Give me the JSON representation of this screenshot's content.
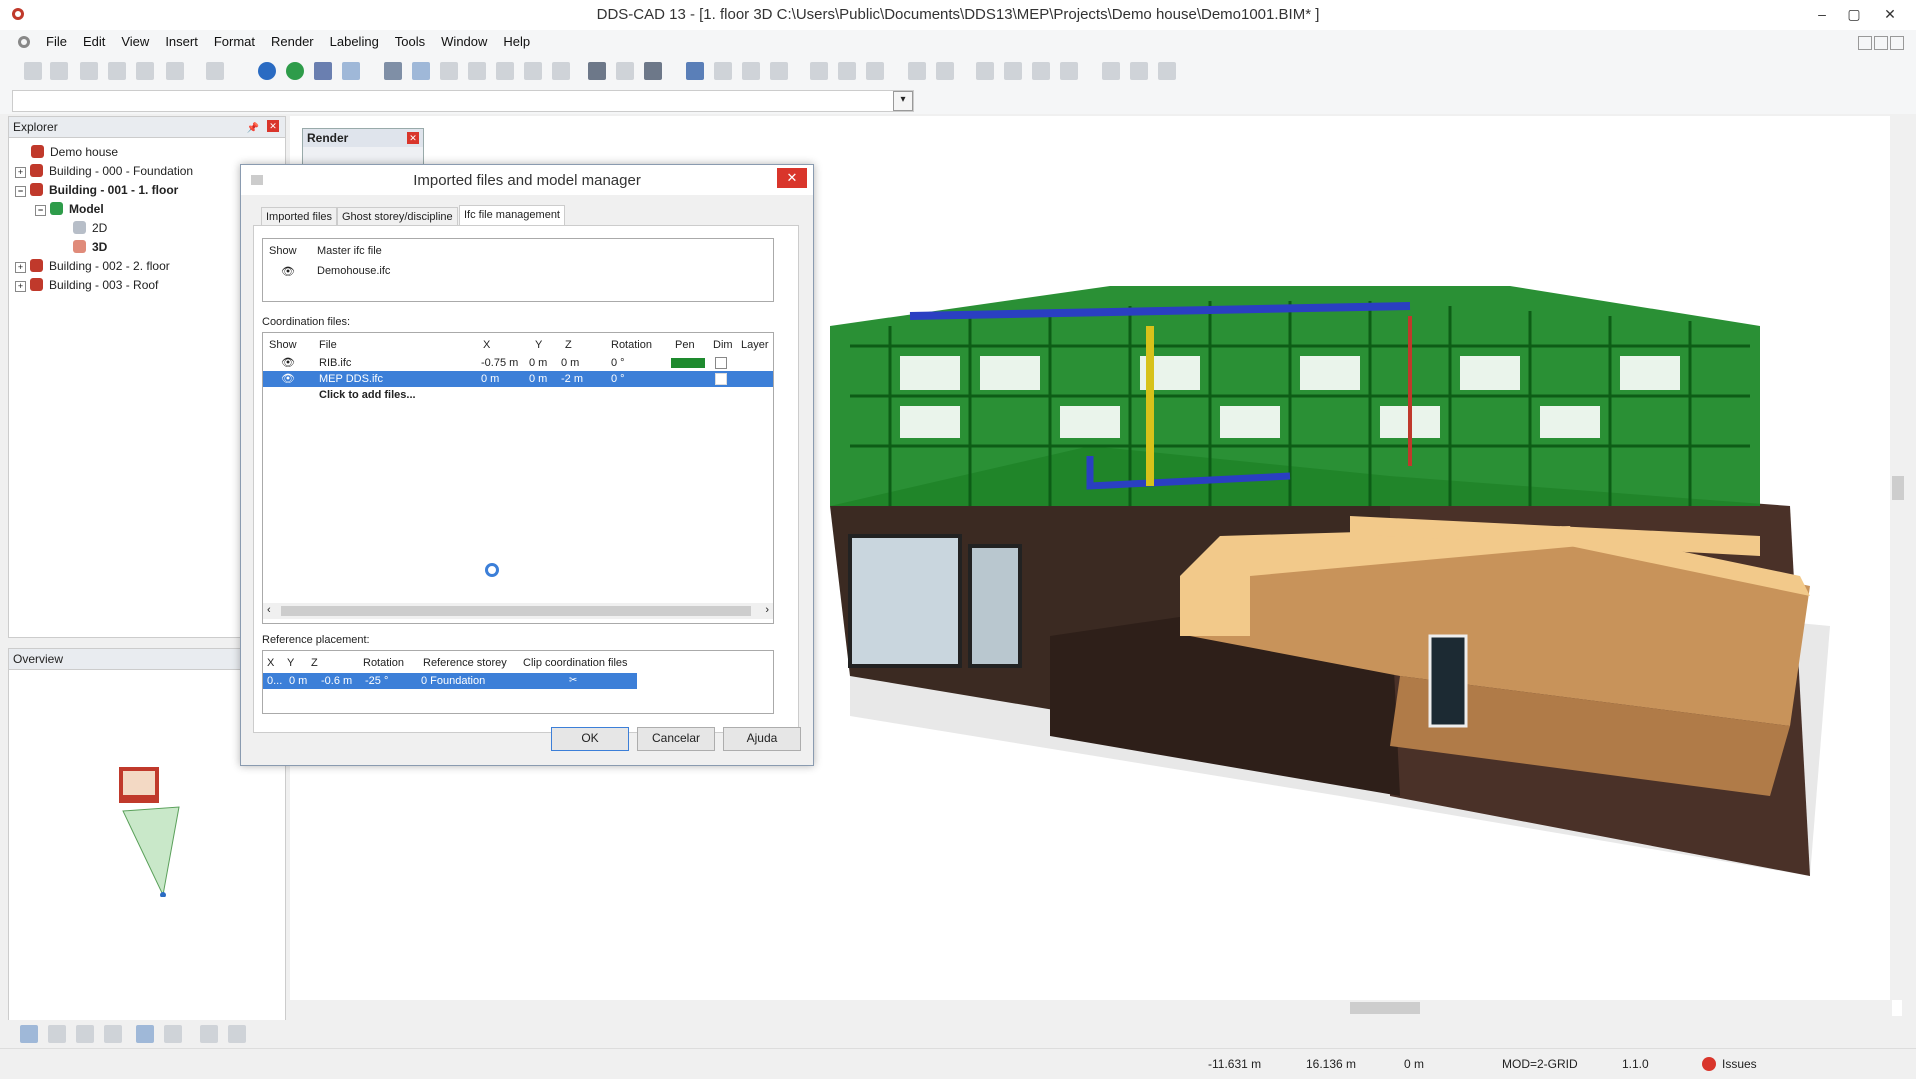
{
  "window": {
    "title": "DDS-CAD 13 - [1. floor  3D  C:\\Users\\Public\\Documents\\DDS13\\MEP\\Projects\\Demo house\\Demo1001.BIM* ]",
    "minimize": "–",
    "maximize": "▢",
    "close": "✕"
  },
  "menu": [
    "File",
    "Edit",
    "View",
    "Insert",
    "Format",
    "Render",
    "Labeling",
    "Tools",
    "Window",
    "Help"
  ],
  "explorer": {
    "title": "Explorer",
    "items": [
      {
        "label": "Demo house",
        "bold": false
      },
      {
        "label": "Building - 000 - Foundation",
        "bold": false
      },
      {
        "label": "Building - 001 - 1. floor",
        "bold": true
      },
      {
        "label": "Model",
        "bold": true
      },
      {
        "label": "2D",
        "bold": false
      },
      {
        "label": "3D",
        "bold": true
      },
      {
        "label": "Building - 002 - 2. floor",
        "bold": false
      },
      {
        "label": "Building - 003 - Roof",
        "bold": false
      }
    ]
  },
  "overview": {
    "title": "Overview"
  },
  "render_panel": {
    "title": "Render"
  },
  "dialog": {
    "title": "Imported files and model manager",
    "tabs": [
      "Imported files",
      "Ghost storey/discipline",
      "Ifc file management"
    ],
    "master": {
      "headers": [
        "Show",
        "Master ifc file"
      ],
      "file": "Demohouse.ifc"
    },
    "coordination": {
      "label": "Coordination files:",
      "headers": [
        "Show",
        "File",
        "X",
        "Y",
        "Z",
        "Rotation",
        "Pen",
        "Dim",
        "Layer"
      ],
      "rows": [
        {
          "file": "RIB.ifc",
          "x": "-0.75 m",
          "y": "0 m",
          "z": "0 m",
          "rotation": "0 °",
          "pen_color": "#1e8a2e"
        },
        {
          "file": "MEP DDS.ifc",
          "x": "0 m",
          "y": "0 m",
          "z": "-2 m",
          "rotation": "0 °",
          "pen_color": ""
        }
      ],
      "add_files": "Click to add files..."
    },
    "reference": {
      "label": "Reference placement:",
      "headers": [
        "X",
        "Y",
        "Z",
        "Rotation",
        "Reference storey",
        "Clip coordination files"
      ],
      "row": {
        "x": "0...",
        "y": "0 m",
        "z": "-0.6 m",
        "rotation": "-25 °",
        "storey": "0  Foundation"
      }
    },
    "buttons": {
      "ok": "OK",
      "cancel": "Cancelar",
      "help": "Ajuda"
    }
  },
  "status": {
    "x": "-11.631 m",
    "y": "16.136 m",
    "z": "0 m",
    "grid": "MOD=2-GRID",
    "version": "1.1.0",
    "issues": "Issues"
  },
  "colors": {
    "selection": "#3c7fd8",
    "accent_green": "#1e8a2e",
    "close_red": "#d9352b"
  }
}
